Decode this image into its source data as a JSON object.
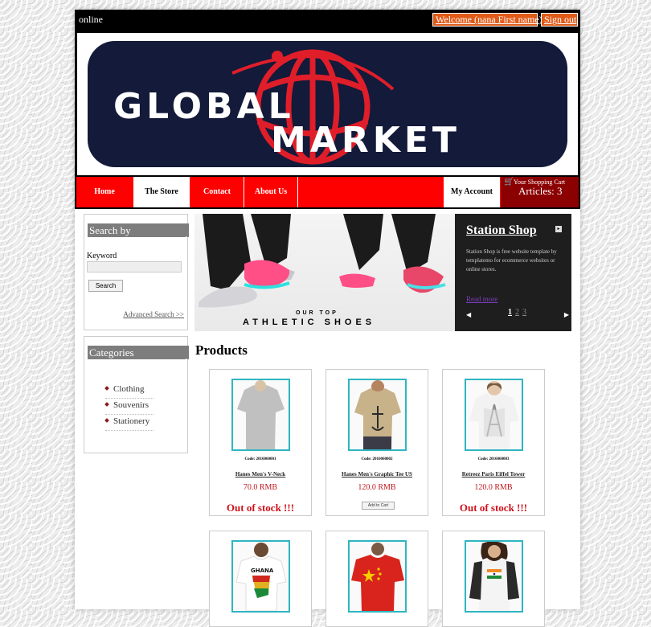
{
  "topbar": {
    "status": "online",
    "welcome": "Welcome (nana First name)",
    "signout": "Sign out"
  },
  "banner": {
    "logo_line1": "GLOBAL",
    "logo_line2": "MARKET",
    "colors": {
      "background": "#131a3a",
      "accent": "#e01e2a",
      "text": "#ffffff"
    }
  },
  "nav": {
    "items": [
      {
        "label": "Home"
      },
      {
        "label": "The Store",
        "active": true
      },
      {
        "label": "Contact"
      },
      {
        "label": "About Us"
      }
    ],
    "account": "My Account",
    "cart": {
      "title": "Your Shopping Cart",
      "count": "Articles: 3"
    }
  },
  "search": {
    "title": "Search by",
    "keyword_label": "Keyword",
    "keyword_value": "",
    "button": "Search",
    "advanced": "Advanced Search >>"
  },
  "categories": {
    "title": "Categories",
    "items": [
      "Clothing",
      "Souvenirs",
      "Stationery"
    ]
  },
  "slider": {
    "tagline1": "OUR TOP",
    "tagline2": "ATHLETIC SHOES",
    "panel_title": "Station Shop",
    "panel_text": "Station Shop is free website template by templatemo for ecommerce websites or online stores.",
    "read_more": "Read more",
    "pages": [
      "1",
      "2",
      "3"
    ],
    "current_page": "1"
  },
  "products": {
    "title": "Products",
    "items": [
      {
        "code": "Code: 2016060001",
        "name": "Hanes Men's V-Neck",
        "price": "70.0 RMB",
        "status": "Out of stock !!!",
        "shirt_color": "#8a8a8a"
      },
      {
        "code": "Code: 2016060002",
        "name": "Hanes Men's Graphic Tee US",
        "price": "120.0 RMB",
        "action": "Add to Cart",
        "shirt_color": "#c8b28a"
      },
      {
        "code": "Code: 2016060003",
        "name": "Retreez Paris Eiffel Tower",
        "price": "120.0 RMB",
        "status": "Out of stock !!!",
        "shirt_color": "#f2f2f2"
      },
      {
        "shirt_color": "#ffffff",
        "print": "GHANA"
      },
      {
        "shirt_color": "#d8241c"
      },
      {
        "shirt_color": "#f4f4f4"
      }
    ]
  }
}
